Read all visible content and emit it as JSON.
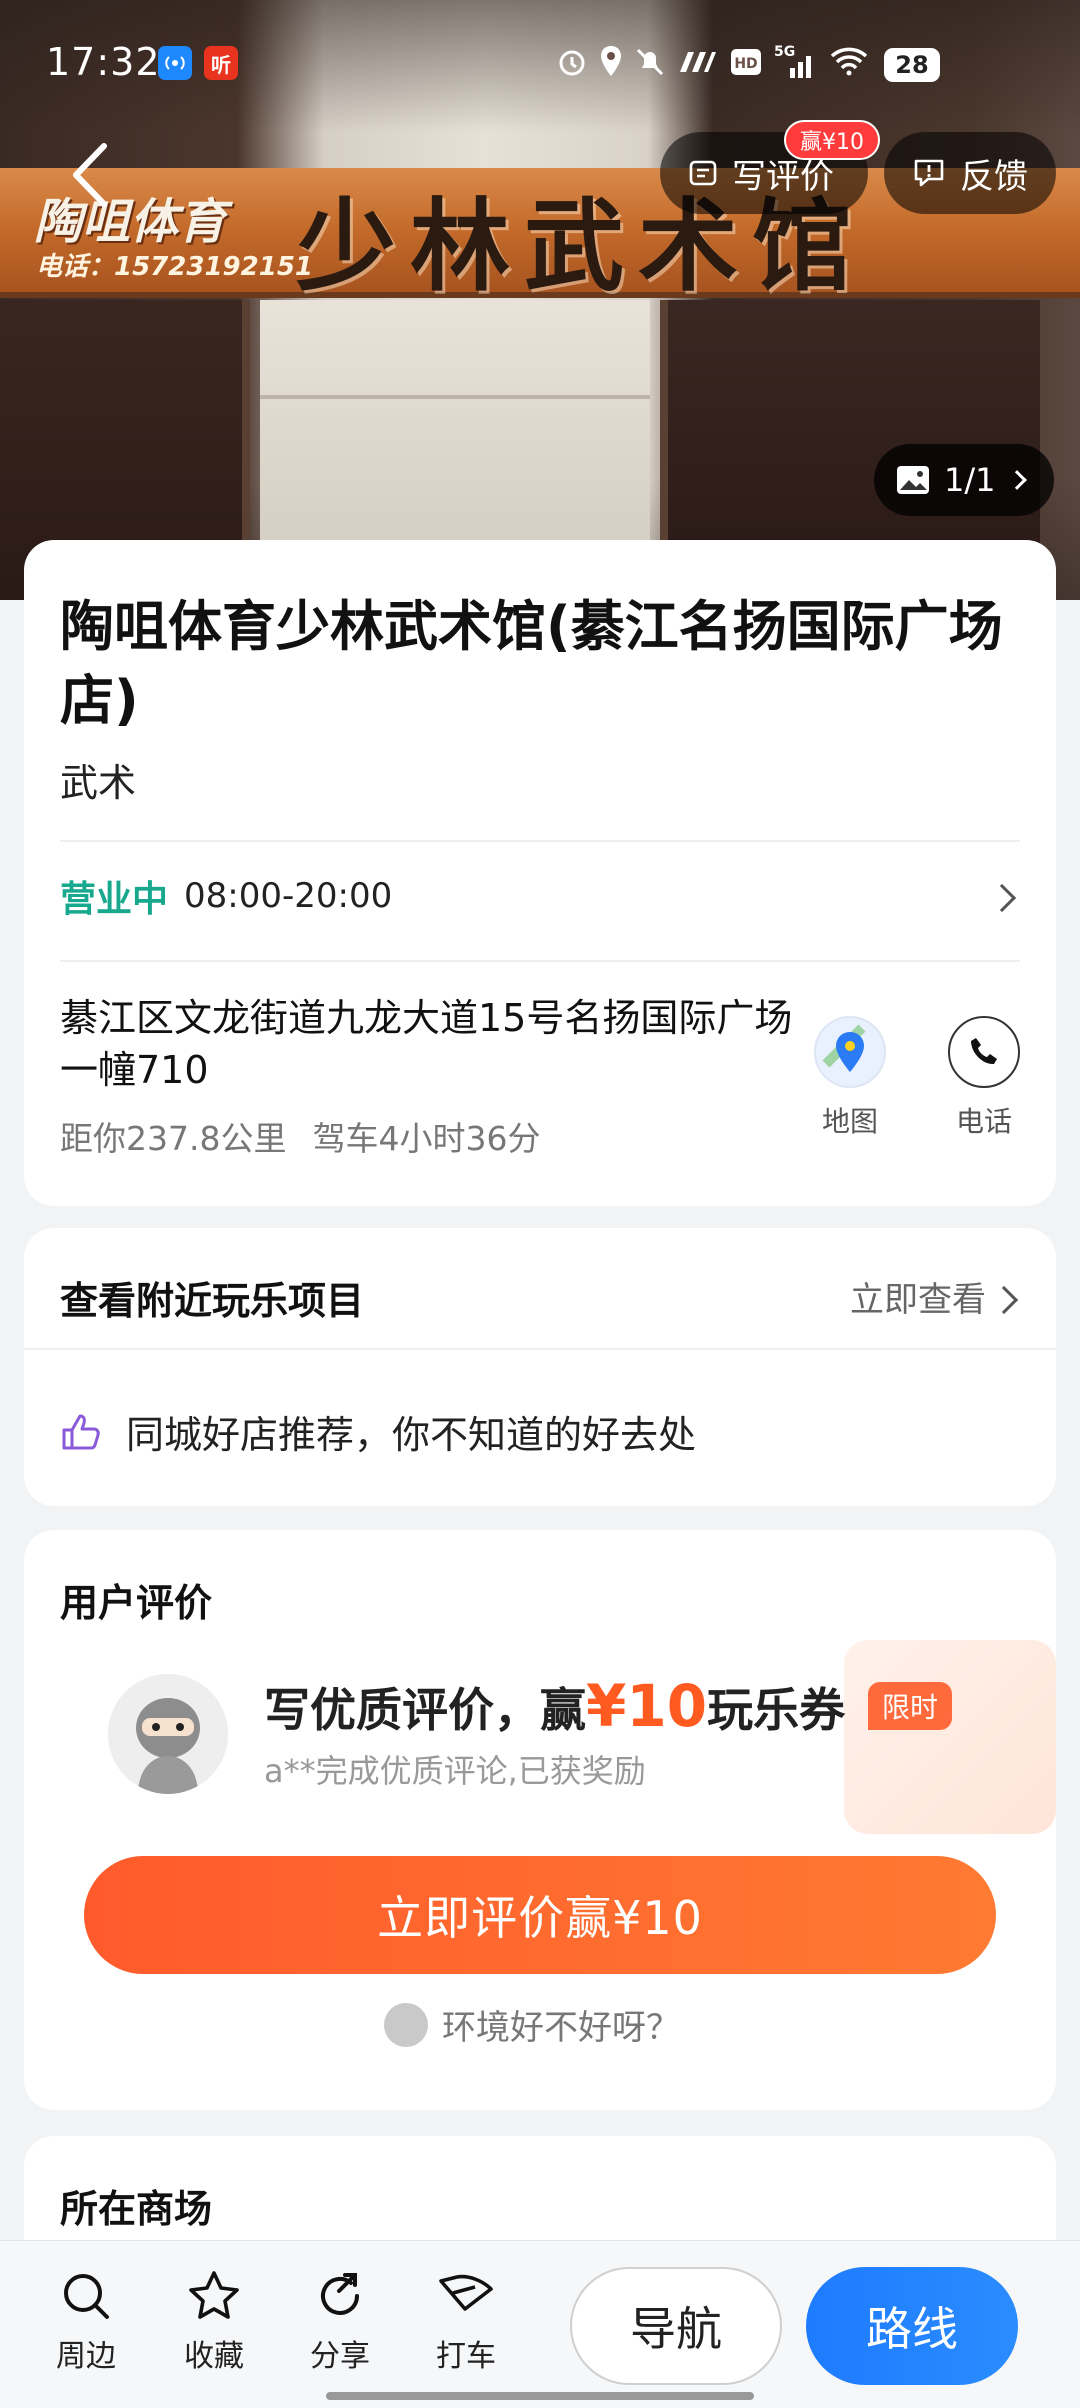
{
  "status_bar": {
    "time": "17:32",
    "app_icon_2": "听",
    "battery": "28"
  },
  "hero": {
    "sign_left": "陶咀体育",
    "sign_phone": "电话：15723192151",
    "sign_main": "少林武术馆",
    "photo_count": "1/1"
  },
  "header": {
    "review_label": "写评价",
    "review_badge": "赢¥10",
    "feedback_label": "反馈"
  },
  "store": {
    "title": "陶咀体育少林武术馆(綦江名扬国际广场店)",
    "category": "武术",
    "open_status": "营业中",
    "hours": "08:00-20:00",
    "address": "綦江区文龙街道九龙大道15号名扬国际广场一幢710",
    "distance": "距你237.8公里",
    "drive_time": "驾车4小时36分",
    "map_label": "地图",
    "phone_label": "电话"
  },
  "nearby": {
    "title": "查看附近玩乐项目",
    "link": "立即查看",
    "recommend": "同城好店推荐，你不知道的好去处"
  },
  "reviews": {
    "title": "用户评价",
    "promo_prefix": "写优质评价，赢",
    "promo_amount": "¥10",
    "promo_suffix": "玩乐券",
    "limited_tag": "限时",
    "promo_sub": "a**完成优质评论,已获奖励",
    "cta": "立即评价赢¥10",
    "question": "环境好不好呀？"
  },
  "mall": {
    "title": "所在商场"
  },
  "bottom_bar": {
    "nearby": "周边",
    "favorite": "收藏",
    "share": "分享",
    "taxi": "打车",
    "navigate": "导航",
    "route": "路线"
  },
  "colors": {
    "open_green": "#17a88e",
    "promo_orange": "#ff5a1f",
    "route_blue": "#1e7bff"
  }
}
